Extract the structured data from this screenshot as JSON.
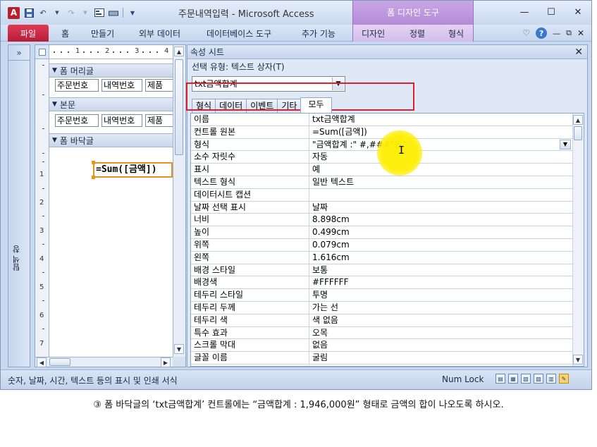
{
  "window": {
    "title": "주문내역입력 - Microsoft Access",
    "context_tab_group": "폼 디자인 도구",
    "controls": {
      "minimize": "—",
      "maximize": "☐",
      "close": "✕"
    }
  },
  "qat": {
    "logo": "A",
    "save_icon": "save-icon",
    "undo_icon": "undo-icon",
    "redo_icon": "redo-icon"
  },
  "ribbon": {
    "file_tab": "파일",
    "tabs": [
      "홈",
      "만들기",
      "외부 데이터",
      "데이터베이스 도구",
      "추가 기능",
      "디자인",
      "정렬",
      "형식"
    ],
    "right": {
      "collapse": "♡",
      "help": "?"
    }
  },
  "nav_pane": {
    "label": "탐색 창",
    "expand": "»"
  },
  "designer": {
    "hruler": [
      "1",
      "2",
      "3",
      "4"
    ],
    "vruler": [
      "1",
      "2",
      "3",
      "4",
      "5",
      "6",
      "7"
    ],
    "sections": {
      "header": "폼 머리글",
      "detail": "본문",
      "footer": "폼 바닥글"
    },
    "header_controls": [
      "주문번호",
      "내역번호",
      "제품"
    ],
    "detail_controls": [
      "주문번호",
      "내역번호",
      "제품"
    ],
    "footer_control": "=Sum([금액])"
  },
  "property_sheet": {
    "title": "속성 시트",
    "selection_type": "선택 유형:  텍스트 상자(T)",
    "selected_object": "txt금액합계",
    "tabs": [
      "형식",
      "데이터",
      "이벤트",
      "기타",
      "모두"
    ],
    "active_tab": "모두",
    "rows": [
      {
        "name": "이름",
        "value": "txt금액합계"
      },
      {
        "name": "컨트롤 원본",
        "value": "=Sum([금액])"
      },
      {
        "name": "형식",
        "value": "\"금액합계 :\" #,###\"원\""
      },
      {
        "name": "소수 자릿수",
        "value": "자동"
      },
      {
        "name": "표시",
        "value": "예"
      },
      {
        "name": "텍스트 형식",
        "value": "일반 텍스트"
      },
      {
        "name": "데이터시트 캡션",
        "value": ""
      },
      {
        "name": "날짜 선택 표시",
        "value": "날짜"
      },
      {
        "name": "너비",
        "value": "8.898cm"
      },
      {
        "name": "높이",
        "value": "0.499cm"
      },
      {
        "name": "위쪽",
        "value": "0.079cm"
      },
      {
        "name": "왼쪽",
        "value": "1.616cm"
      },
      {
        "name": "배경 스타일",
        "value": "보통"
      },
      {
        "name": "배경색",
        "value": "#FFFFFF"
      },
      {
        "name": "테두리 스타일",
        "value": "투명"
      },
      {
        "name": "테두리 두께",
        "value": "가는 선"
      },
      {
        "name": "테두리 색",
        "value": "색 없음"
      },
      {
        "name": "특수 효과",
        "value": "오목"
      },
      {
        "name": "스크롤 막대",
        "value": "없음"
      },
      {
        "name": "글꼴 이름",
        "value": "굴림"
      }
    ]
  },
  "status_bar": {
    "text": "숫자, 날짜, 시간, 텍스트 등의 표시 및 인쇄 서식",
    "numlock": "Num Lock"
  },
  "instruction": "③ 폼 바닥글의 ‘txt금액합계’ 컨트롤에는 “금액합계 : 1,946,000원” 형태로 금액의 합이 나오도록 하시오.",
  "colors": {
    "file_tab": "#c8223b",
    "context_tab": "#b48ad8",
    "highlight": "#e0202c",
    "cursor_glow": "#ffee00"
  }
}
